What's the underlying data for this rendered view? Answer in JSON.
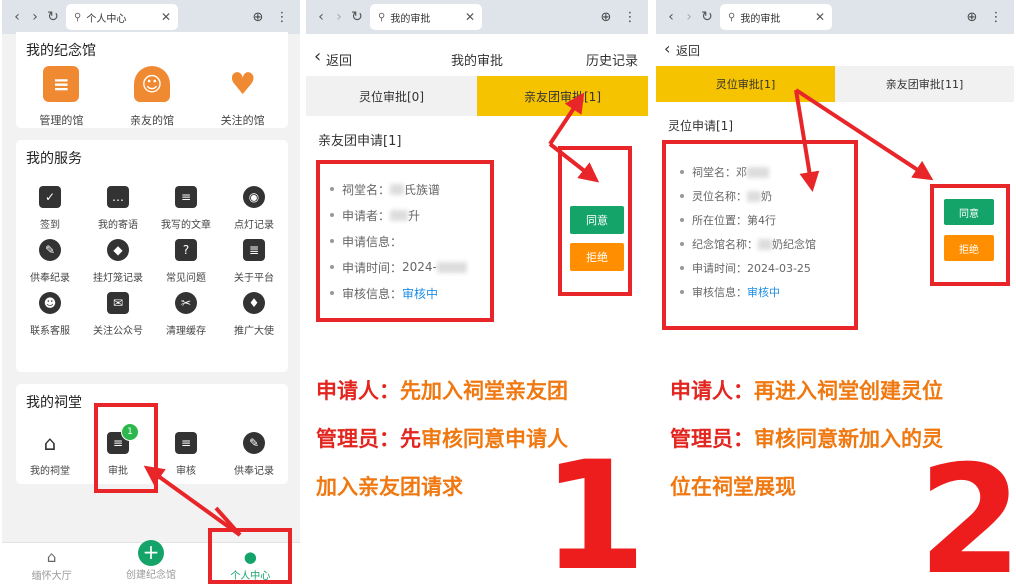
{
  "panel1": {
    "browser": {
      "tab_title": "个人中心"
    },
    "memorial": {
      "title": "我的纪念馆",
      "items": [
        {
          "label": "管理的馆",
          "icon": "hall-icon",
          "color": "#f08a32"
        },
        {
          "label": "亲友的馆",
          "icon": "people-icon",
          "color": "#f08a32"
        },
        {
          "label": "关注的馆",
          "icon": "heart-icon",
          "color": "#f08a32"
        }
      ]
    },
    "services": {
      "title": "我的服务",
      "items": [
        {
          "label": "签到",
          "icon": "calendar-icon",
          "glyph": "✓"
        },
        {
          "label": "我的寄语",
          "icon": "chat-icon",
          "glyph": "…"
        },
        {
          "label": "我写的文章",
          "icon": "list-icon",
          "glyph": "≡"
        },
        {
          "label": "点灯记录",
          "icon": "lamp-record-icon",
          "glyph": "◉"
        },
        {
          "label": "供奉纪录",
          "icon": "offering-icon",
          "glyph": "✎"
        },
        {
          "label": "挂灯笼记录",
          "icon": "lantern-icon",
          "glyph": "◆"
        },
        {
          "label": "常见问题",
          "icon": "question-icon",
          "glyph": "?"
        },
        {
          "label": "关于平台",
          "icon": "document-icon",
          "glyph": "≣"
        },
        {
          "label": "联系客服",
          "icon": "support-icon",
          "glyph": "☻"
        },
        {
          "label": "关注公众号",
          "icon": "wechat-icon",
          "glyph": "✉"
        },
        {
          "label": "清理缓存",
          "icon": "broom-icon",
          "glyph": "✂"
        },
        {
          "label": "推广大使",
          "icon": "handshake-icon",
          "glyph": "♦"
        }
      ]
    },
    "ancestral": {
      "title": "我的祠堂",
      "items": [
        {
          "label": "我的祠堂",
          "icon": "temple-icon",
          "glyph": "⌂"
        },
        {
          "label": "审批",
          "icon": "approval-icon",
          "glyph": "≡",
          "badge": "1"
        },
        {
          "label": "审核",
          "icon": "review-icon",
          "glyph": "≡"
        },
        {
          "label": "供奉记录",
          "icon": "offering-record-icon",
          "glyph": "✎"
        }
      ]
    },
    "bottom_nav": [
      {
        "label": "缅怀大厅",
        "icon": "home-icon",
        "glyph": "⌂"
      },
      {
        "label": "创建纪念馆",
        "icon": "plus-circle-icon",
        "glyph": "+"
      },
      {
        "label": "个人中心",
        "icon": "user-icon",
        "glyph": "●"
      }
    ]
  },
  "panel2": {
    "browser": {
      "tab_title": "我的审批"
    },
    "header": {
      "back": "返回",
      "title": "我的审批",
      "history": "历史记录"
    },
    "tabs": [
      {
        "label": "灵位审批[0]"
      },
      {
        "label": "亲友团审批[1]"
      }
    ],
    "section": "亲友团申请[1]",
    "fields": [
      {
        "label": "祠堂名：",
        "value": "氏族谱"
      },
      {
        "label": "申请者：",
        "value": "升"
      },
      {
        "label": "申请信息：",
        "value": ""
      },
      {
        "label": "申请时间：",
        "value": "2024-"
      },
      {
        "label": "审核信息：",
        "value": "审核中"
      }
    ],
    "buttons": {
      "agree": "同意",
      "reject": "拒绝"
    },
    "caption": [
      {
        "key": "申请人：",
        "text": "先加入祠堂亲友团"
      },
      {
        "key": "管理员：先",
        "text": "审核同意申请人"
      },
      {
        "key": "",
        "text": "加入亲友团请求"
      }
    ],
    "step": "1"
  },
  "panel3": {
    "browser": {
      "tab_title": "我的审批"
    },
    "header": {
      "back": "返回"
    },
    "tabs": [
      {
        "label": "灵位审批[1]"
      },
      {
        "label": "亲友团审批[11]"
      }
    ],
    "section": "灵位申请[1]",
    "fields": [
      {
        "label": "祠堂名：",
        "value": "邓"
      },
      {
        "label": "灵位名称：",
        "value": "奶"
      },
      {
        "label": "所在位置：",
        "value": "第4行"
      },
      {
        "label": "纪念馆名称：",
        "value": "奶纪念馆"
      },
      {
        "label": "申请时间：",
        "value": "2024-03-25"
      },
      {
        "label": "审核信息：",
        "value": "审核中"
      }
    ],
    "buttons": {
      "agree": "同意",
      "reject": "拒绝"
    },
    "caption": [
      {
        "key": "申请人：",
        "text": "再进入祠堂创建灵位"
      },
      {
        "key": "管理员：",
        "text": "审核同意新加入的灵"
      },
      {
        "key": "",
        "text": "位在祠堂展现"
      }
    ],
    "step": "2"
  },
  "colors": {
    "accent": "#f6c300",
    "agree": "#14a46a",
    "reject": "#ff8f00",
    "annotation": "#e8262a",
    "link": "#1e8ee6"
  }
}
